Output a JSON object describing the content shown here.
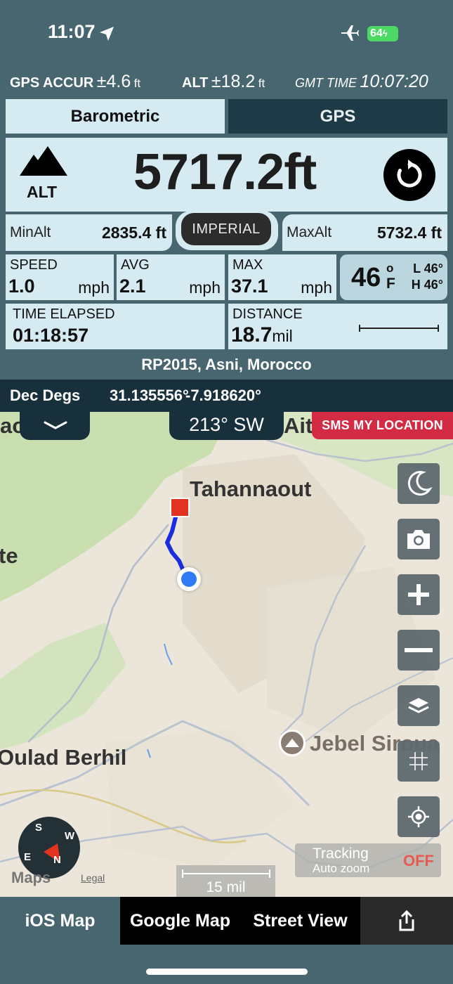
{
  "status": {
    "time": "11:07",
    "battery": "64"
  },
  "accuracy": {
    "gps_label": "GPS ACCUR",
    "pm": "±",
    "gps_value": "4.6",
    "gps_unit": "ft",
    "alt_label": "ALT",
    "alt_value": "18.2",
    "alt_unit": "ft",
    "gmt_label": "GMT TIME",
    "gmt_value": "10:07:20"
  },
  "tabs": {
    "barometric": "Barometric",
    "gps": "GPS"
  },
  "altitude": {
    "label": "ALT",
    "value": "5717.2ft",
    "min_label": "MinAlt",
    "min_value": "2835.4 ft",
    "max_label": "MaxAlt",
    "max_value": "5732.4 ft",
    "units_button": "IMPERIAL"
  },
  "stats": {
    "speed_label": "SPEED",
    "speed_value": "1.0",
    "avg_label": "AVG",
    "avg_value": "2.1",
    "max_label": "MAX",
    "max_value": "37.1",
    "speed_unit": "mph",
    "time_label": "TIME ELAPSED",
    "time_value": "01:18:57",
    "distance_label": "DISTANCE",
    "distance_value": "18.7",
    "distance_unit": "mil"
  },
  "weather": {
    "temp": "46",
    "deg": "o",
    "unit": "F",
    "low": "L 46°",
    "high": "H 46°"
  },
  "place": "RP2015, Asni, Morocco",
  "coords": {
    "label": "Dec Degs",
    "lat": "31.135556°",
    "lon": "-7.918620°"
  },
  "map": {
    "heading": "213° SW",
    "sms_button": "SMS MY LOCATION",
    "labels": {
      "tahannaout": "Tahannaout",
      "jebel": "Jebel Siroua",
      "oulad": "Oulad Berhil",
      "partial_top_left": "aou",
      "partial_left": "te",
      "partial_top": "Ait"
    },
    "tracking_title": "Tracking",
    "tracking_sub": "Auto zoom",
    "tracking_state": "OFF",
    "scale": "15 mil",
    "maps_brand": "Maps",
    "legal": "Legal",
    "compass": {
      "n": "N",
      "s": "S",
      "e": "E",
      "w": "W"
    }
  },
  "bottom_tabs": {
    "ios_map": "iOS Map",
    "google_map": "Google Map",
    "street_view": "Street View"
  },
  "colors": {
    "panel": "#d6eaf1",
    "header_bg": "#476670",
    "dark_bar": "#17303b",
    "sms_red": "#d42b44",
    "track_blue": "#1a2ee0",
    "location_dot": "#2f7cf6"
  },
  "icons": {
    "location_arrow": "location-arrow-icon",
    "airplane": "airplane-icon",
    "mountain": "mountain-icon",
    "reset": "reset-icon",
    "moon": "moon-icon",
    "camera": "camera-icon",
    "plus": "zoom-in-icon",
    "minus": "zoom-out-icon",
    "layers": "layers-icon",
    "grid": "grid-icon",
    "locate": "locate-icon",
    "share": "share-icon"
  }
}
